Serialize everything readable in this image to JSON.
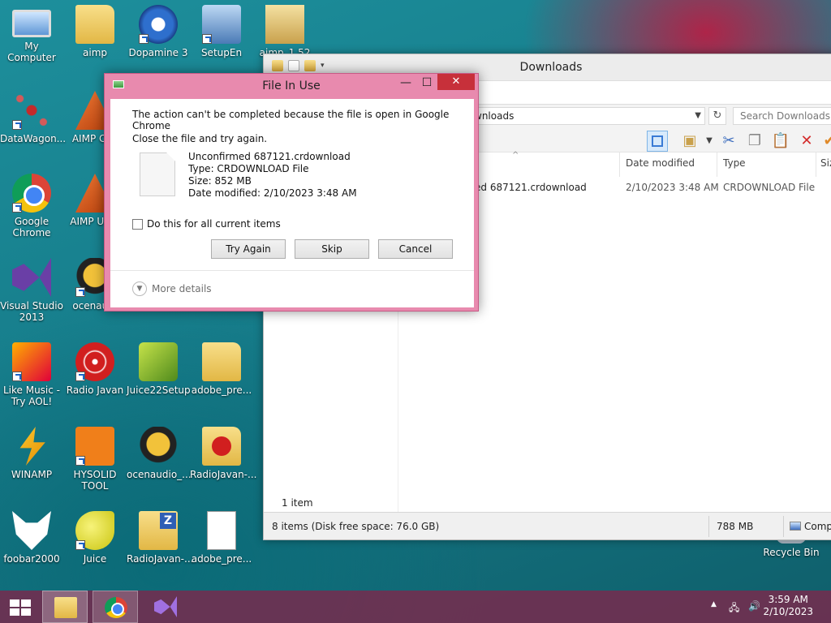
{
  "desktop": {
    "icons": [
      {
        "label": "My Computer"
      },
      {
        "label": "aimp"
      },
      {
        "label": "Dopamine 3"
      },
      {
        "label": "SetupEn"
      },
      {
        "label": "aimp_1.52"
      },
      {
        "label": "DataWagon..."
      },
      {
        "label": "AIMP Cl..."
      },
      {
        "label": "Google Chrome"
      },
      {
        "label": "AIMP Uti..."
      },
      {
        "label": "Visual Studio 2013"
      },
      {
        "label": "ocenau..."
      },
      {
        "label": "Like Music - Try AOL!"
      },
      {
        "label": "Radio Javan"
      },
      {
        "label": "Juice22Setup"
      },
      {
        "label": "adobe_pre..."
      },
      {
        "label": "WINAMP"
      },
      {
        "label": "HYSOLID TOOL"
      },
      {
        "label": "ocenaudio_..."
      },
      {
        "label": "RadioJavan-..."
      },
      {
        "label": "foobar2000"
      },
      {
        "label": "Juice"
      },
      {
        "label": "RadioJavan-..."
      },
      {
        "label": "adobe_pre..."
      },
      {
        "label": "Recycle Bin"
      }
    ]
  },
  "explorer": {
    "title": "Downloads",
    "address": "wnloads",
    "search_placeholder": "Search Downloads",
    "columns": {
      "date": "Date modified",
      "type": "Type",
      "size": "Siz"
    },
    "row": {
      "name": "ed 687121.crdownload",
      "date": "2/10/2023 3:48 AM",
      "type": "CRDOWNLOAD File"
    },
    "item_count": "1 item",
    "status": {
      "items": "8 items (Disk free space: 76.0 GB)",
      "size": "788 MB",
      "location": "Comp"
    }
  },
  "dialog": {
    "title": "File In Use",
    "message": "The action can't be completed because the file is open in Google Chrome",
    "sub_message": "Close the file and try again.",
    "file": {
      "name": "Unconfirmed 687121.crdownload",
      "type": "Type: CRDOWNLOAD File",
      "size": "Size: 852 MB",
      "date": "Date modified: 2/10/2023 3:48 AM"
    },
    "checkbox_label": "Do this for all current items",
    "buttons": {
      "try_again": "Try Again",
      "skip": "Skip",
      "cancel": "Cancel"
    },
    "more_details": "More details"
  },
  "taskbar": {
    "time": "3:59 AM",
    "date": "2/10/2023"
  }
}
